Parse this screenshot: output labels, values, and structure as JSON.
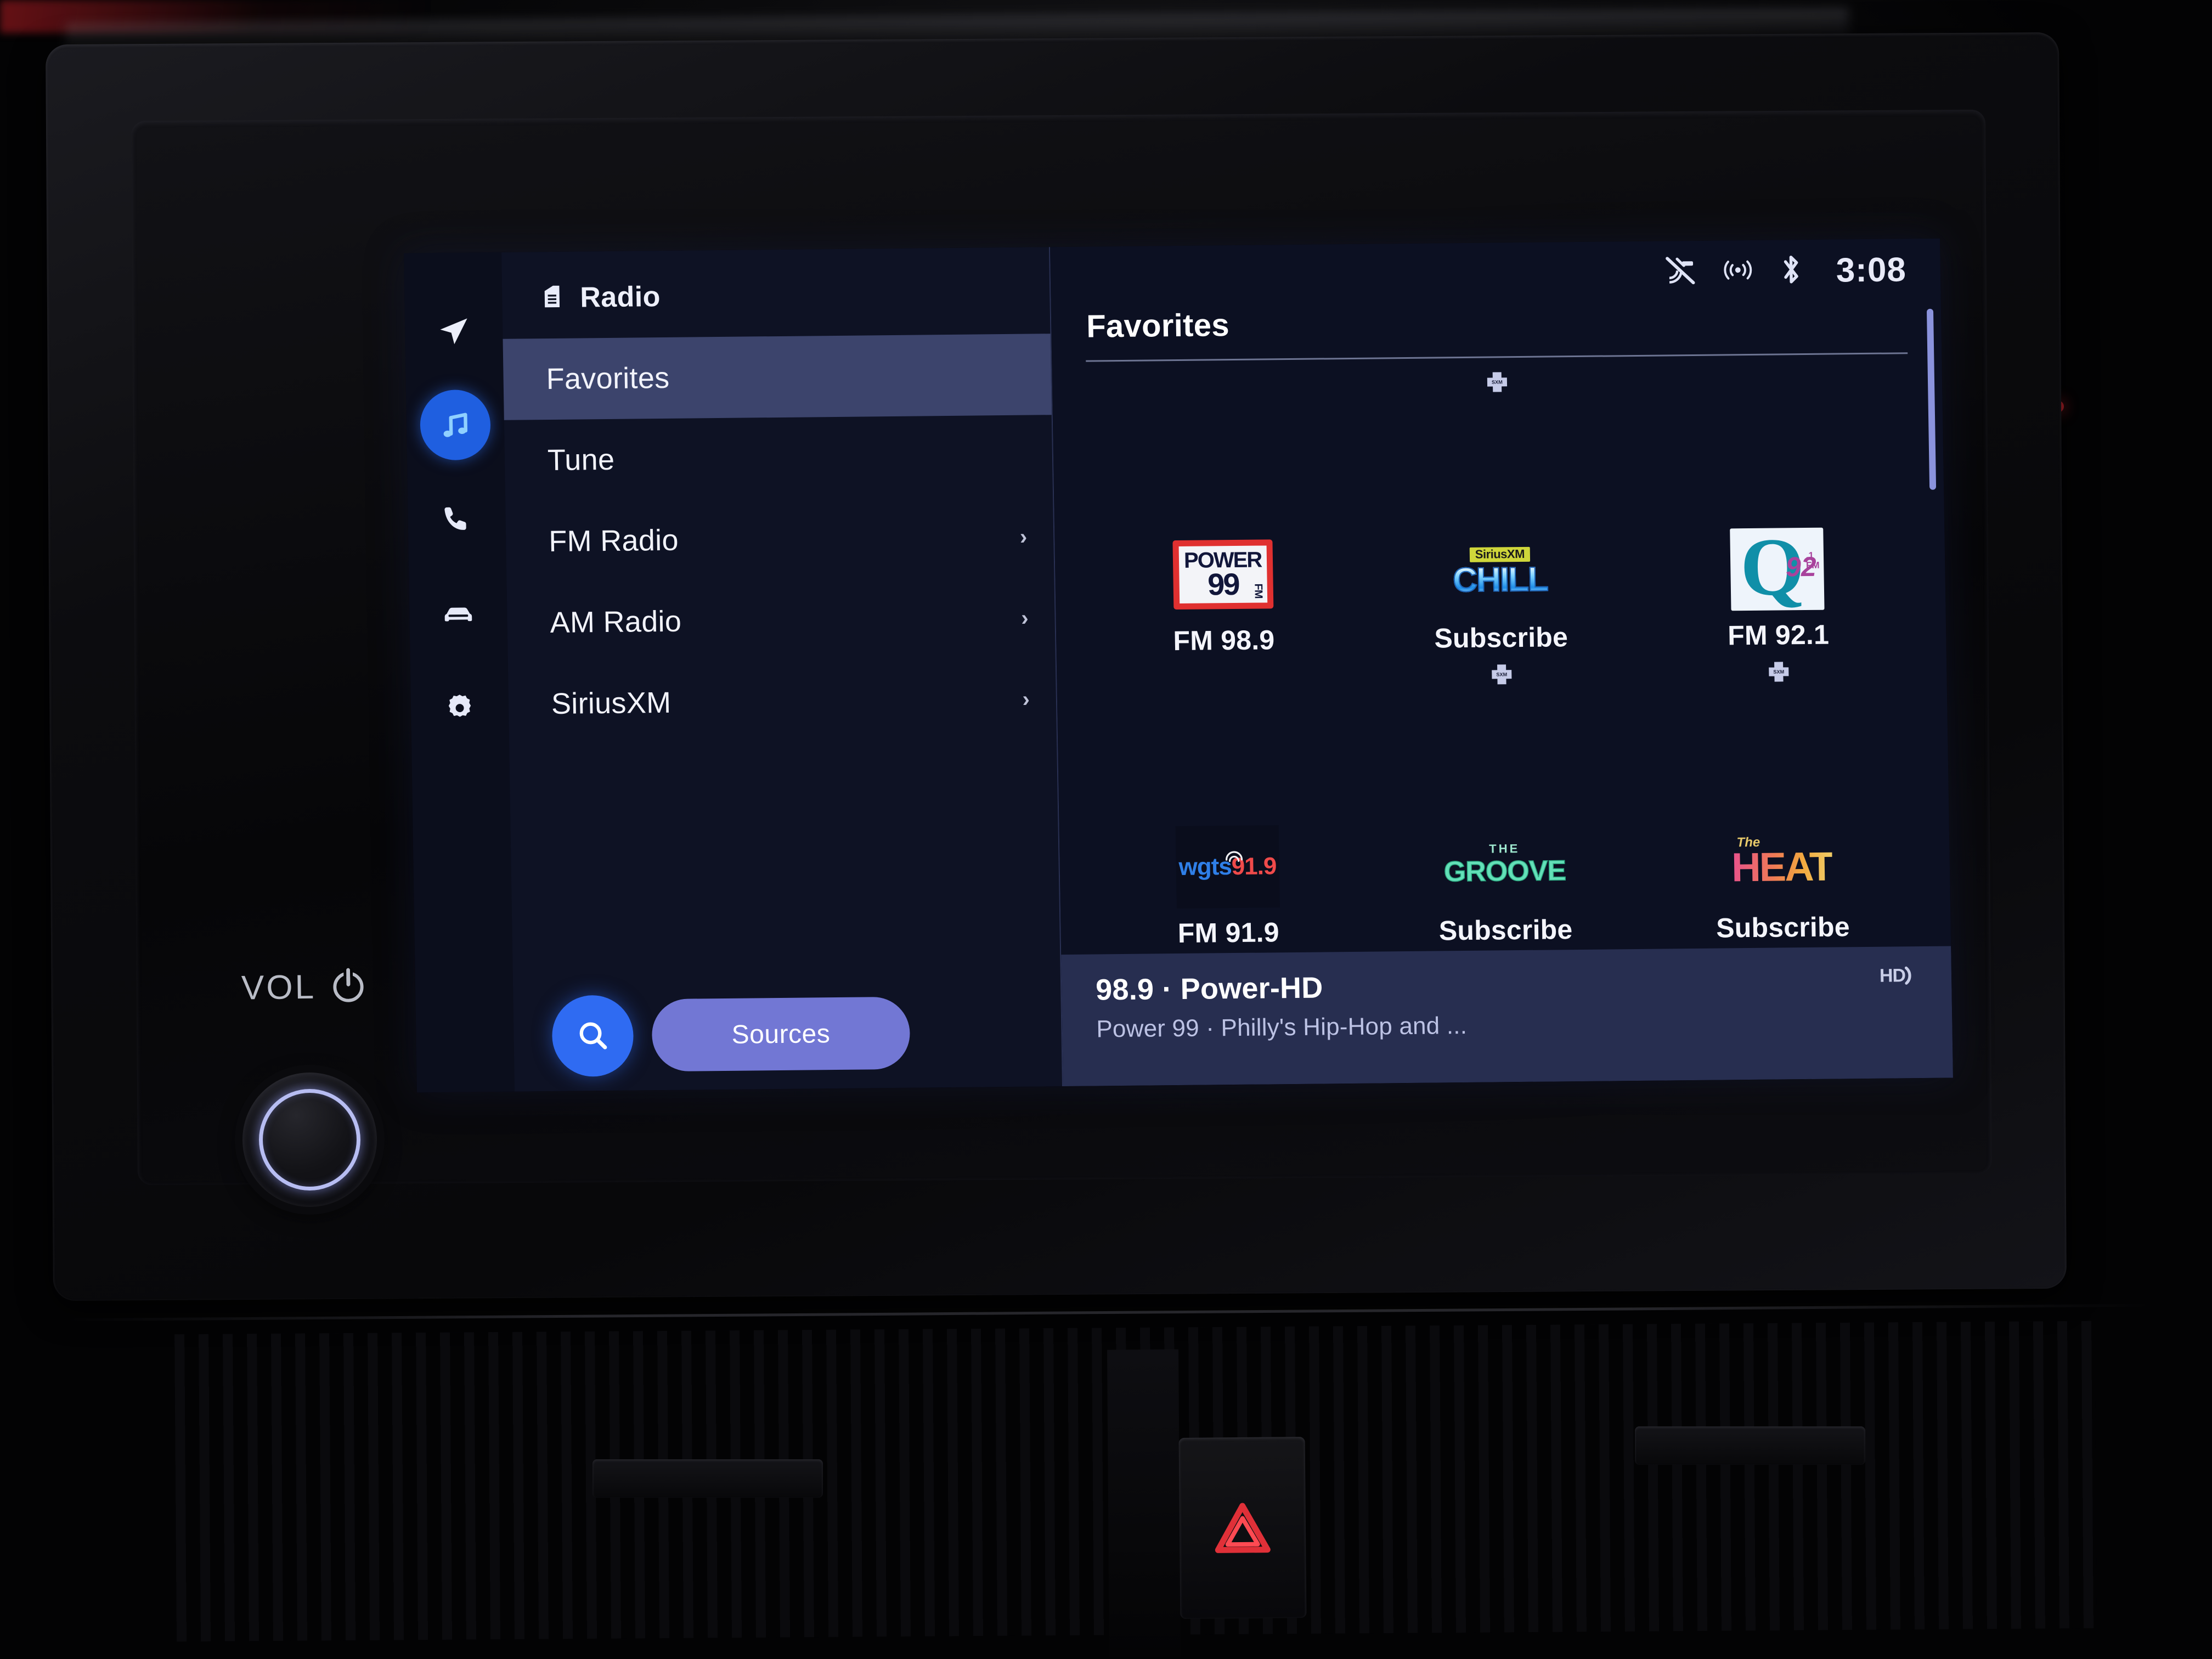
{
  "statusbar": {
    "clock": "3:08",
    "icons": [
      {
        "name": "satellite-off-icon",
        "label": "Satellite Off"
      },
      {
        "name": "wireless-signal-icon",
        "label": "Wireless"
      },
      {
        "name": "bluetooth-icon",
        "label": "Bluetooth"
      }
    ]
  },
  "rail": {
    "items": [
      {
        "name": "navigation",
        "icon": "navigation-arrow-icon",
        "label": "Navigation",
        "active": false
      },
      {
        "name": "media",
        "icon": "music-note-icon",
        "label": "Media",
        "active": true
      },
      {
        "name": "phone",
        "icon": "phone-icon",
        "label": "Phone",
        "active": false
      },
      {
        "name": "vehicle",
        "icon": "car-icon",
        "label": "Vehicle",
        "active": false
      },
      {
        "name": "settings",
        "icon": "gear-icon",
        "label": "Settings",
        "active": false
      }
    ]
  },
  "menu": {
    "header_icon": "radio-icon",
    "header_label": "Radio",
    "items": [
      {
        "label": "Favorites",
        "selected": true,
        "chevron": ""
      },
      {
        "label": "Tune",
        "selected": false,
        "chevron": ""
      },
      {
        "label": "FM Radio",
        "selected": false,
        "chevron": "›"
      },
      {
        "label": "AM Radio",
        "selected": false,
        "chevron": "›"
      },
      {
        "label": "SiriusXM",
        "selected": false,
        "chevron": "›"
      }
    ],
    "search_label": "Search",
    "sources_label": "Sources"
  },
  "favorites": {
    "title": "Favorites",
    "tiles": [
      {
        "logo": "power-99",
        "label": "FM 98.9",
        "badge": false,
        "text": {
          "top": "POWER",
          "bottom": "99",
          "side": "FM"
        }
      },
      {
        "logo": "siriusxm-chill",
        "label": "Subscribe",
        "badge": true,
        "text": {
          "brand": "SiriusXM",
          "name": "CHILL"
        }
      },
      {
        "logo": "q-92-1",
        "label": "FM 92.1",
        "badge": false,
        "text": {
          "q": "Q",
          "num": "92",
          "sub1": ".1",
          "sub2": "FM"
        }
      },
      {
        "logo": "wgts-91-9",
        "label": "FM 91.9",
        "badge": false,
        "text": {
          "call": "wgts",
          "freq": "91.9"
        }
      },
      {
        "logo": "the-groove",
        "label": "Subscribe",
        "badge": true,
        "text": {
          "the": "THE",
          "name": "GROOVE"
        }
      },
      {
        "logo": "the-heat",
        "label": "Subscribe",
        "badge": true,
        "text": {
          "the": "The",
          "name": "HEAT"
        }
      }
    ]
  },
  "now_playing": {
    "title": "98.9 · Power-HD",
    "subtitle": "Power 99 · Philly's Hip-Hop and ...",
    "hd_badge": "HD"
  },
  "hardware": {
    "vol_label": "VOL",
    "power_icon": "power-icon",
    "knob_name": "volume-knob",
    "hazard_icon": "hazard-triangle-icon"
  },
  "colors": {
    "accent_blue": "#2f6bf2",
    "sources_indigo": "#7277d4",
    "selected_row": "#3c446c",
    "nowplaying_bg": "#272e50",
    "screen_bg": "#0c1022",
    "menu_bg": "#0e1224"
  }
}
